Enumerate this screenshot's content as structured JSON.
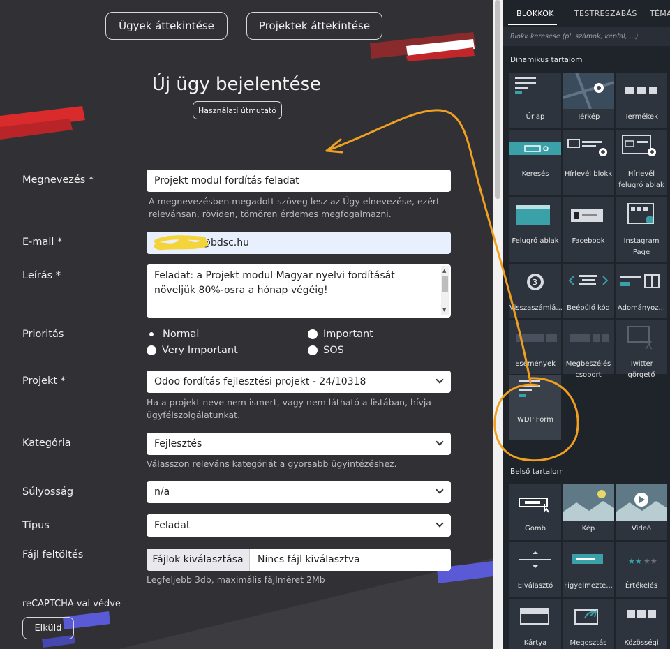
{
  "top_buttons": {
    "cases": "Ügyek áttekintése",
    "projects": "Projektek áttekintése"
  },
  "page_title": "Új ügy bejelentése",
  "guide_label": "Használati útmutató",
  "form": {
    "name": {
      "label": "Megnevezés *",
      "value": "Projekt modul fordítás feladat",
      "help": "A megnevezésben megadott szöveg lesz az Ügy elnevezése, ezért relevánsan, röviden, tömören érdemes megfogalmazni."
    },
    "email": {
      "label": "E-mail *",
      "value": "@bdsc.hu"
    },
    "description": {
      "label": "Leírás *",
      "value": "Feladat: a Projekt modul Magyar nyelvi fordítását növeljük 80%-osra a hónap végéig!"
    },
    "priority": {
      "label": "Prioritás",
      "options": [
        "Normal",
        "Important",
        "Very Important",
        "SOS"
      ],
      "selected": "Normal"
    },
    "project": {
      "label": "Projekt *",
      "value": "Odoo fordítás fejlesztési projekt - 24/10318",
      "help": "Ha a projekt neve nem ismert, vagy nem látható a listában, hívja ügyfélszolgálatunkat."
    },
    "category": {
      "label": "Kategória",
      "value": "Fejlesztés",
      "help": "Válasszon releváns kategóriát a gyorsabb ügyintézéshez."
    },
    "severity": {
      "label": "Súlyosság",
      "value": "n/a"
    },
    "type": {
      "label": "Típus",
      "value": "Feladat"
    },
    "upload": {
      "label": "Fájl feltöltés",
      "button": "Fájlok kiválasztása",
      "status": "Nincs fájl kiválasztva",
      "help": "Legfeljebb 3db, maximális fájlméret 2Mb"
    },
    "recaptcha": "reCAPTCHA-val védve",
    "submit": "Elküld"
  },
  "sidebar": {
    "tabs": [
      "BLOKKOK",
      "TESTRESZABÁS",
      "TÉMA"
    ],
    "active_tab": "BLOKKOK",
    "search_placeholder": "Blokk keresése (pl. számok, képfal, ...)",
    "sections": [
      {
        "title": "Dinamikus tartalom",
        "tiles": [
          {
            "label": "Űrlap",
            "icon": "form-icon"
          },
          {
            "label": "Térkép",
            "icon": "map-icon"
          },
          {
            "label": "Termékek",
            "icon": "products-icon"
          },
          {
            "label": "Keresés",
            "icon": "search-block-icon"
          },
          {
            "label": "Hírlevél blokk",
            "icon": "newsletter-block-icon"
          },
          {
            "label": "Hírlevél felugró ablak",
            "icon": "newsletter-popup-icon"
          },
          {
            "label": "Felugró ablak",
            "icon": "popup-icon"
          },
          {
            "label": "Facebook",
            "icon": "facebook-icon"
          },
          {
            "label": "Instagram Page",
            "icon": "instagram-icon"
          },
          {
            "label": "Visszaszámlá...",
            "icon": "countdown-icon"
          },
          {
            "label": "Beépülő kód",
            "icon": "embed-code-icon"
          },
          {
            "label": "Adományoz...",
            "icon": "donation-icon"
          },
          {
            "label": "Események",
            "icon": "events-icon"
          },
          {
            "label": "Megbeszélés csoport",
            "icon": "meeting-group-icon"
          },
          {
            "label": "Twitter görgető",
            "icon": "twitter-scroller-icon"
          },
          {
            "label": "WDP Form",
            "icon": "wdp-form-icon"
          }
        ]
      },
      {
        "title": "Belső tartalom",
        "tiles": [
          {
            "label": "Gomb",
            "icon": "button-block-icon"
          },
          {
            "label": "Kép",
            "icon": "image-icon"
          },
          {
            "label": "Videó",
            "icon": "video-icon"
          },
          {
            "label": "Elválasztó",
            "icon": "separator-icon"
          },
          {
            "label": "Figyelmezte...",
            "icon": "alert-icon"
          },
          {
            "label": "Értékelés",
            "icon": "rating-icon"
          },
          {
            "label": "Kártya",
            "icon": "card-icon"
          },
          {
            "label": "Megosztás",
            "icon": "share-icon"
          },
          {
            "label": "Közösségi",
            "icon": "social-icon"
          }
        ]
      }
    ]
  },
  "colors": {
    "form_bg": "#313135",
    "sidebar_bg": "#1f232a",
    "tile_bg": "#2e343d",
    "annotation": "#f0a020",
    "accent_red": "#d92b2b",
    "accent_purple": "#5a5ad6"
  }
}
